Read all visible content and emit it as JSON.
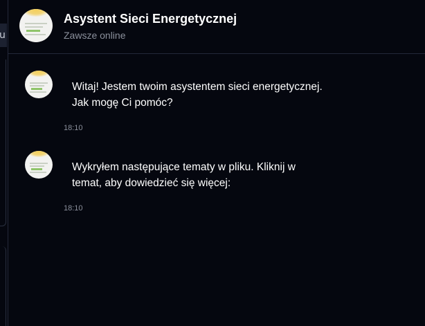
{
  "background_tab": {
    "label_fragment": "u"
  },
  "chat": {
    "bot_name": "Asystent Sieci Energetycznej",
    "status": "Zawsze online",
    "avatar_icon": "energy-assistant-avatar-icon",
    "messages": [
      {
        "text_line1": "Witaj! Jestem twoim asystentem sieci energetycznej.",
        "text_line2": "Jak mogę Ci pomóc?",
        "time": "18:10"
      },
      {
        "text_line1": "Wykryłem następujące tematy w pliku. Kliknij w",
        "text_line2": "temat, aby dowiedzieć się więcej:",
        "time": "18:10"
      }
    ]
  },
  "colors": {
    "background": "#05070f",
    "text_primary": "#ffffff",
    "text_muted": "#8b909c",
    "border": "#23283a"
  }
}
